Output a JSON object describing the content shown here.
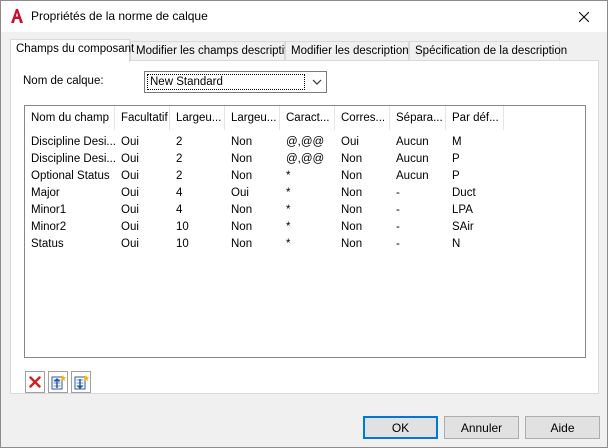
{
  "window": {
    "title": "Propriétés de la norme de calque"
  },
  "tabs": [
    {
      "label": "Champs du composant"
    },
    {
      "label": "Modifier les champs descriptifs"
    },
    {
      "label": "Modifier les descriptions"
    },
    {
      "label": "Spécification de la description"
    }
  ],
  "layer_standard": {
    "label": "Nom de calque:",
    "value": "New Standard"
  },
  "columns": [
    "Nom du champ",
    "Facultatif",
    "Largeu...",
    "Largeu...",
    "Caract...",
    "Corres...",
    "Sépara...",
    "Par déf..."
  ],
  "rows": [
    [
      "Discipline Desi...",
      "Oui",
      "2",
      "Non",
      "@,@@",
      "Oui",
      "Aucun",
      "M"
    ],
    [
      "Discipline Desi...",
      "Oui",
      "2",
      "Non",
      "@,@@",
      "Non",
      "Aucun",
      "P"
    ],
    [
      "Optional Status",
      "Oui",
      "2",
      "Non",
      "*",
      "Non",
      "Aucun",
      "P"
    ],
    [
      "Major",
      "Oui",
      "4",
      "Oui",
      "*",
      "Non",
      "-",
      "Duct"
    ],
    [
      "Minor1",
      "Oui",
      "4",
      "Non",
      "*",
      "Non",
      "-",
      "LPA"
    ],
    [
      "Minor2",
      "Oui",
      "10",
      "Non",
      "*",
      "Non",
      "-",
      "SAir"
    ],
    [
      "Status",
      "Oui",
      "10",
      "Non",
      "*",
      "Non",
      "-",
      "N"
    ]
  ],
  "toolbar": {
    "icons": [
      "delete-icon",
      "move-up-icon",
      "move-down-icon"
    ]
  },
  "buttons": {
    "ok": "OK",
    "cancel": "Annuler",
    "help": "Aide"
  },
  "colors": {
    "accent": "#0078d7",
    "app_icon": "#c8102e"
  }
}
